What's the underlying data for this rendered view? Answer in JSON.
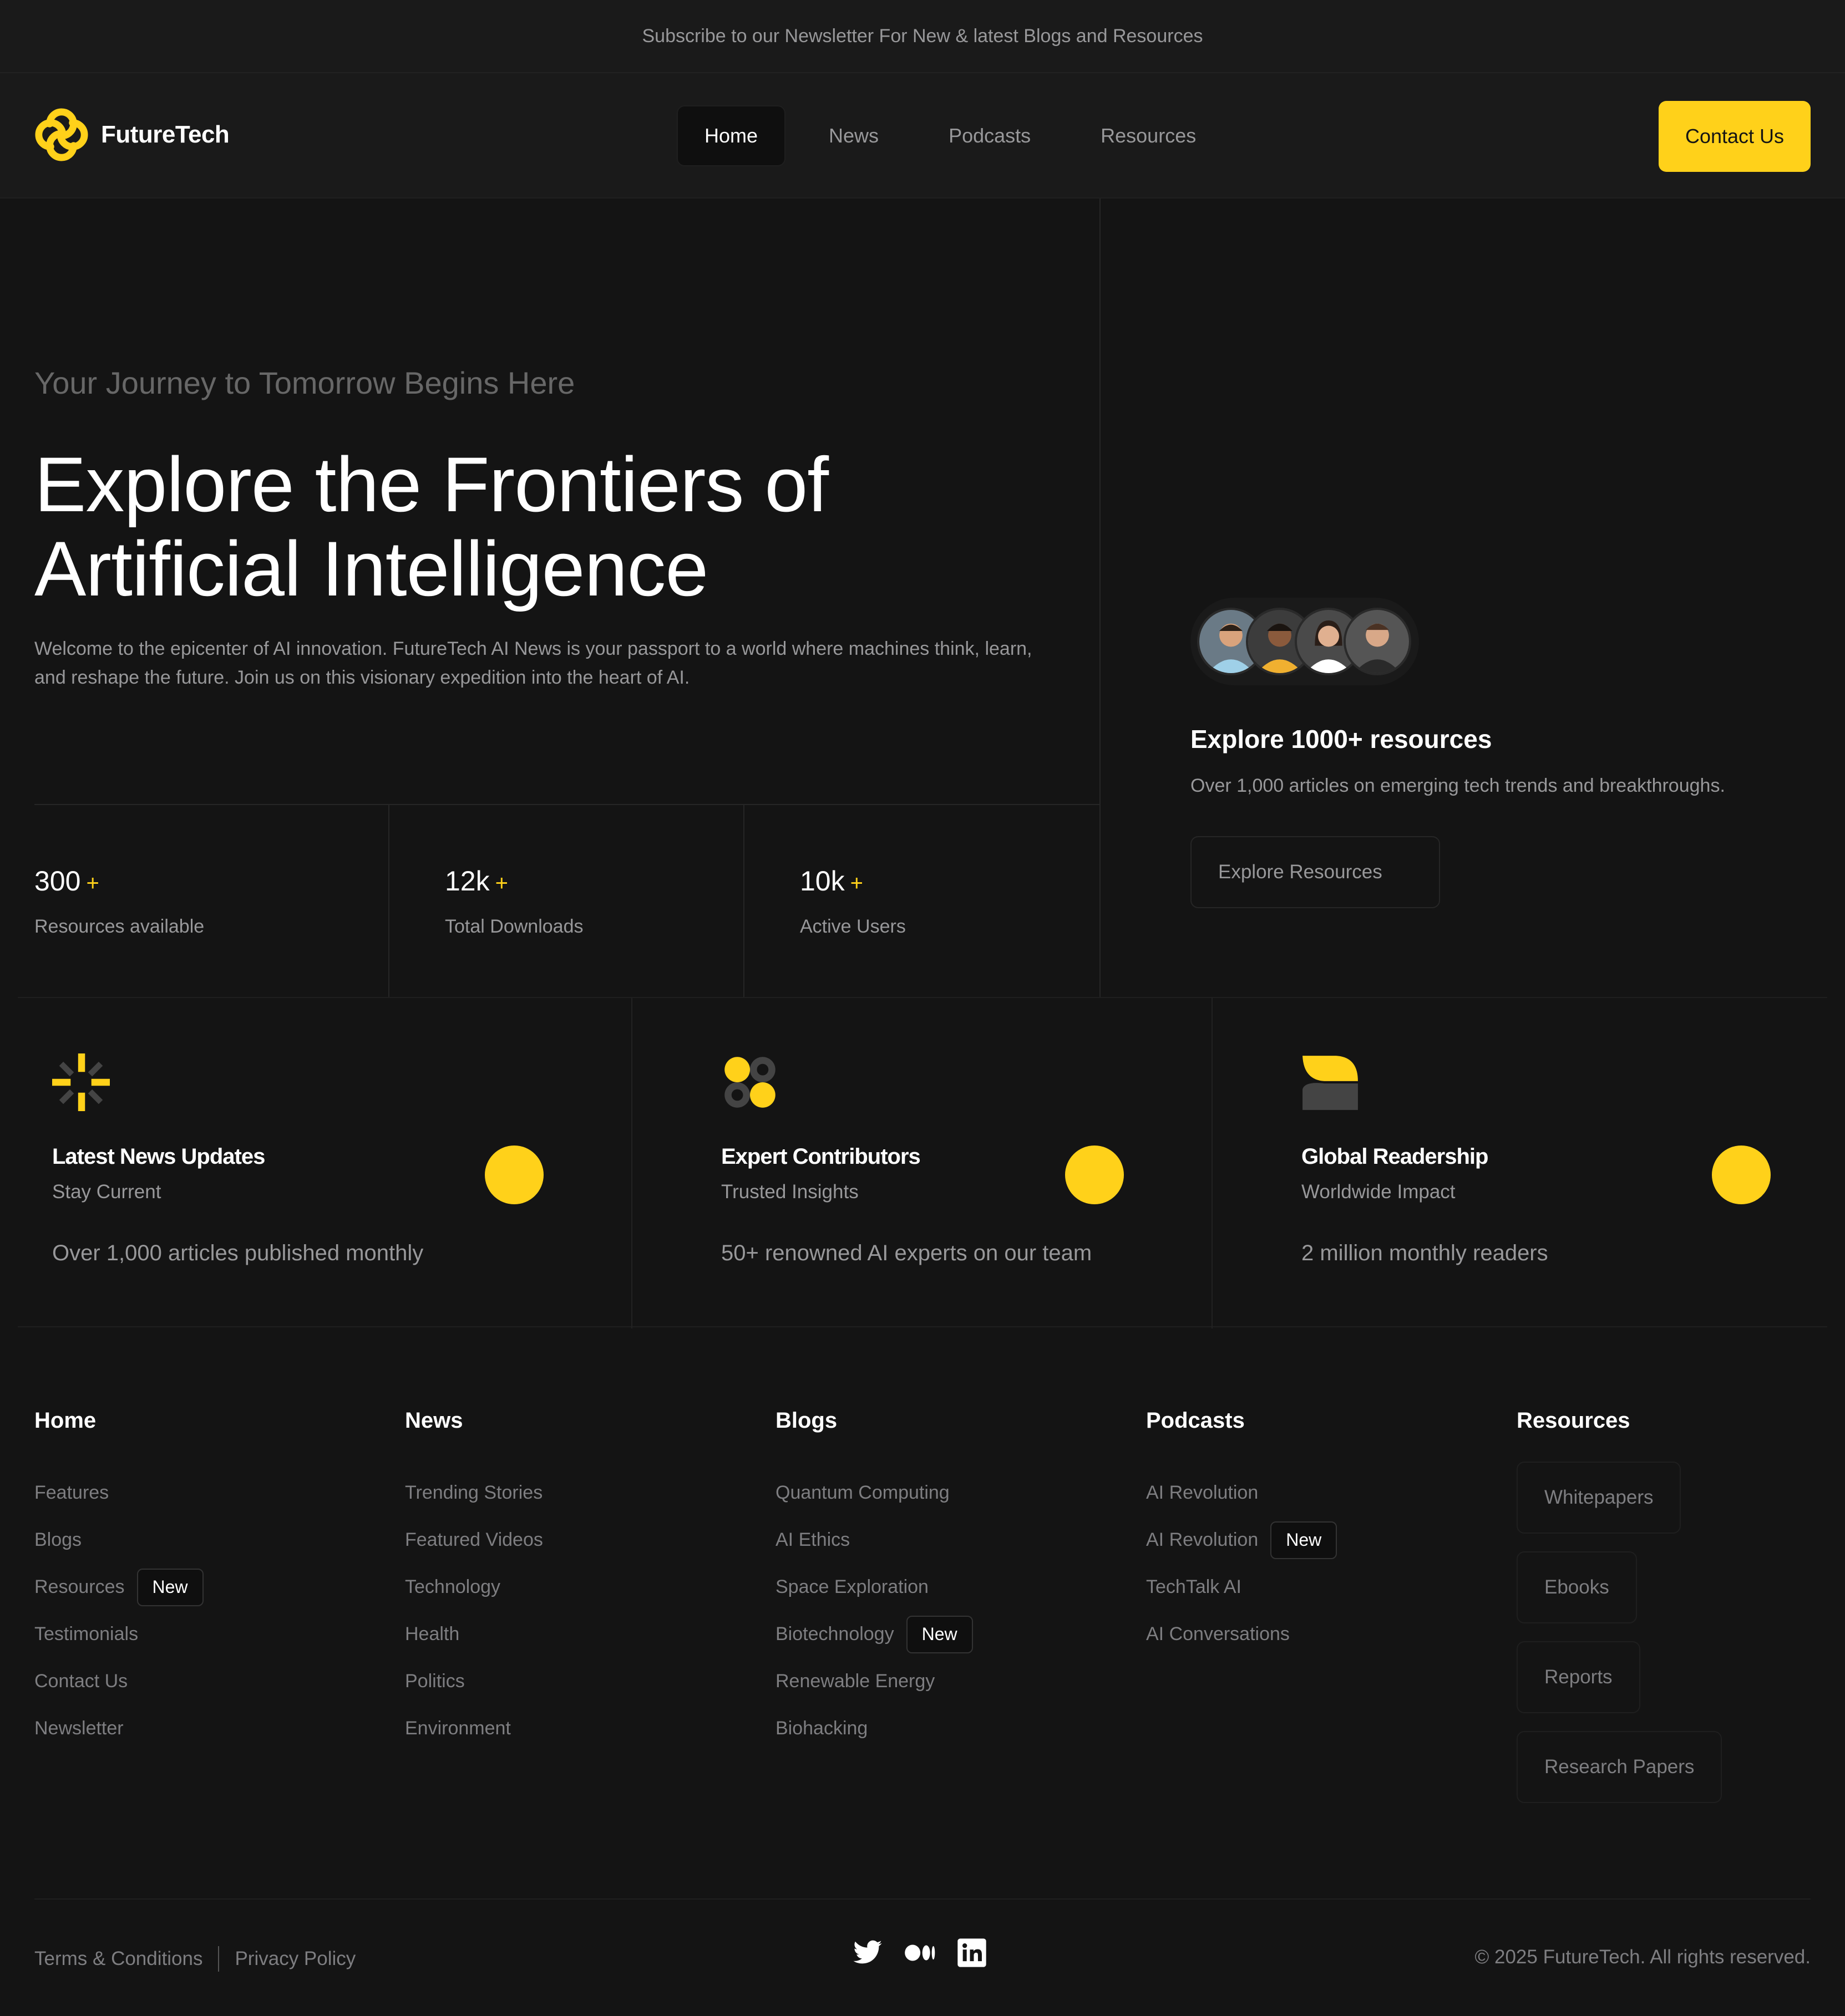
{
  "banner": {
    "text": "Subscribe to our Newsletter For New & latest Blogs and Resources"
  },
  "brand": {
    "name": "FutureTech",
    "accent": "#ffd11a"
  },
  "nav": {
    "links": [
      "Home",
      "News",
      "Podcasts",
      "Resources"
    ],
    "active": "Home",
    "contact_label": "Contact Us"
  },
  "hero": {
    "kicker": "Your Journey to Tomorrow Begins Here",
    "title_line1": "Explore the Frontiers of",
    "title_line2": "Artificial Intelligence",
    "description": "Welcome to the epicenter of AI innovation. FutureTech AI News is your passport to a world where machines think, learn, and reshape the future. Join us on this visionary expedition into the heart of AI.",
    "stats": [
      {
        "value": "300",
        "plus": "+",
        "label": "Resources available"
      },
      {
        "value": "12k",
        "plus": "+",
        "label": "Total Downloads"
      },
      {
        "value": "10k",
        "plus": "+",
        "label": "Active Users"
      }
    ]
  },
  "resources_card": {
    "title": "Explore 1000+ resources",
    "description": "Over 1,000 articles on emerging tech trends and breakthroughs.",
    "button_label": "Explore Resources"
  },
  "features": [
    {
      "icon": "sparkle-icon",
      "title": "Latest News Updates",
      "subtitle": "Stay Current",
      "text": "Over 1,000 articles published monthly"
    },
    {
      "icon": "clover-icon",
      "title": "Expert Contributors",
      "subtitle": "Trusted Insights",
      "text": "50+ renowned AI experts on our team"
    },
    {
      "icon": "leaf-icon",
      "title": "Global Readership",
      "subtitle": "Worldwide Impact",
      "text": "2 million monthly readers"
    }
  ],
  "footer": {
    "home": {
      "heading": "Home",
      "items": [
        "Features",
        "Blogs",
        "Resources",
        "Testimonials",
        "Contact Us",
        "Newsletter"
      ]
    },
    "news": {
      "heading": "News",
      "items": [
        "Trending Stories",
        "Featured Videos",
        "Technology",
        "Health",
        "Politics",
        "Environment"
      ]
    },
    "blogs": {
      "heading": "Blogs",
      "items": [
        "Quantum Computing",
        "AI Ethics",
        "Space Exploration",
        "Biotechnology",
        "Renewable Energy",
        "Biohacking"
      ]
    },
    "podcasts": {
      "heading": "Podcasts",
      "items": [
        "AI Revolution",
        "AI Revolution",
        "TechTalk AI",
        "AI Conversations"
      ]
    },
    "resources": {
      "heading": "Resources",
      "items": [
        "Whitepapers",
        "Ebooks",
        "Reports",
        "Research Papers"
      ]
    },
    "new_badge": "New"
  },
  "bottom": {
    "terms": "Terms & Conditions",
    "privacy": "Privacy Policy",
    "copyright": "© 2025 FutureTech. All rights reserved.",
    "socials": [
      "twitter-icon",
      "medium-icon",
      "linkedin-icon"
    ]
  }
}
